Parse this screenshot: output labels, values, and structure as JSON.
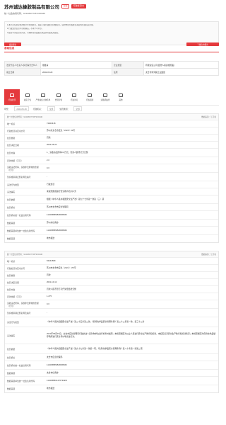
{
  "company": {
    "name": "苏州诚达橡胶制品有限公司",
    "badges": [
      "存续",
      "行政处罚(2)"
    ],
    "credit_code_label": "统一社会信用代码：",
    "credit_code": "91320507735731519M"
  },
  "notice": {
    "lines": [
      "1.本公示信息仅供社会公众查询参考，如需了解行政处罚详细信息，请向作出行政处罚决定的行政机关咨询。",
      "2.行政处罚信息公示期满后，不再予以公示。",
      "3.如对公示信息有异议，可向作出行政处罚决定的行政机关提出。"
    ]
  },
  "actions": {
    "left_btn": "发送报告",
    "right_btn": "下载信用报告"
  },
  "section": {
    "title": "基础信息"
  },
  "basic": {
    "rows": [
      {
        "k1": "法定代表人/负责人/执行事务合伙人",
        "v1": "徐胜青",
        "k2": "企业类型",
        "v2": "有限责任公司(自然人投资或控股)"
      },
      {
        "k1": "成立日期",
        "v1": "2002-05-29",
        "k2": "住所",
        "v2": "太仓市浏河镇工业园区"
      }
    ]
  },
  "tabs": [
    {
      "label": "行政处罚"
    },
    {
      "label": "诚实守信"
    },
    {
      "label": "严重失信主体名单"
    },
    {
      "label": "经营异常"
    },
    {
      "label": "行政许可"
    },
    {
      "label": "行政强制"
    },
    {
      "label": "双随机抽查"
    },
    {
      "label": "其他"
    }
  ],
  "filters": {
    "year_label": "年份：",
    "year_value": "2022-05-29",
    "dept_label": "行政机关：",
    "dept_value": "全部",
    "type_label": "处罚类别：",
    "type_value": "全部"
  },
  "records": [
    {
      "top_left": "统一社会信用代码：91320507735731519M",
      "top_right": "数据来源：江苏省",
      "fields": [
        {
          "k": "唯一标识",
          "v": "74403418"
        },
        {
          "k": "行政处罚决定书文号",
          "v": "苏州市太仓市应急〔2022〕61号"
        },
        {
          "k": "处罚类别",
          "v": "罚款"
        },
        {
          "k": "处罚决定日期",
          "v": "2022-05-20"
        },
        {
          "k": "处罚内容",
          "v": "1、没收违法所得0.0万元；罚款人民币贰万元整"
        },
        {
          "k": "罚款金额（万元）",
          "v": "2.0"
        },
        {
          "k": "没收违法所得、没收非法财物的金额（万元）",
          "v": "0.0"
        },
        {
          "k": "暂扣或吊销证照名称及编号",
          "v": "-"
        },
        {
          "k": "违法行为类型",
          "v": "行政处罚"
        },
        {
          "k": "违法事实",
          "v": "未按照规定履行安全教育培训义务"
        },
        {
          "k": "处罚依据",
          "v": "根据《中华人民共和国安全生产法》第九十七条第一款第（三）项"
        },
        {
          "k": "处罚机关",
          "v": "苏州市太仓市应急管理局"
        },
        {
          "k": "处罚机关统一社会信用代码",
          "v": "11320585MB1839596J"
        },
        {
          "k": "数据来源",
          "v": "苏州市信用办"
        },
        {
          "k": "数据来源单位统一社会信用代码",
          "v": "11320585MB1839596J"
        },
        {
          "k": "数据来源",
          "v": "地市报送"
        }
      ]
    },
    {
      "top_left": "统一社会信用代码：91320507735731519M",
      "top_right": "数据来源：江苏省",
      "fields": [
        {
          "k": "唯一标识",
          "v": "63161589"
        },
        {
          "k": "行政处罚决定书文号",
          "v": "苏州市太仓市应急〔2021〕176号"
        },
        {
          "k": "处罚类别",
          "v": "罚款"
        },
        {
          "k": "处罚决定日期",
          "v": "2021-10-12"
        },
        {
          "k": "处罚内容",
          "v": "罚款人民币壹万贰仟柒佰伍拾元整"
        },
        {
          "k": "罚款金额（万元）",
          "v": "1.275"
        },
        {
          "k": "没收违法所得、没收非法财物的金额（万元）",
          "v": "0.0"
        },
        {
          "k": "暂扣或吊销证照名称及编号",
          "v": "-"
        },
        {
          "k": "违法行为类型",
          "v": "《中华人民共和国安全生产法》第二十五条第二款，《危险化学品安全管理条例》第二十二条第一款、第三十二条"
        },
        {
          "k": "违法事实",
          "v": "2021年09月07日，太仓市应急管理局行政执法人员对你单位进行检查时发现：未按照规定对从业人员进行安全生产教育和培训，未如实记录安全生产教育和培训情况；未按照规定对危险化学品储存场所进行安全评价等违法行为。"
        },
        {
          "k": "处罚依据",
          "v": "《中华人民共和国安全生产法》第九十七条第一款第一项，《危险化学品安全管理条例》第八十条第一款第二项"
        },
        {
          "k": "处罚机关",
          "v": "太仓市应急管理局"
        },
        {
          "k": "处罚机关统一社会信用代码",
          "v": "11320585MB1839596J"
        },
        {
          "k": "数据来源",
          "v": "太仓市信用办"
        },
        {
          "k": "数据来源单位统一社会信用代码",
          "v": "11320585014707319W"
        },
        {
          "k": "数据来源",
          "v": "地市报送"
        }
      ]
    }
  ]
}
